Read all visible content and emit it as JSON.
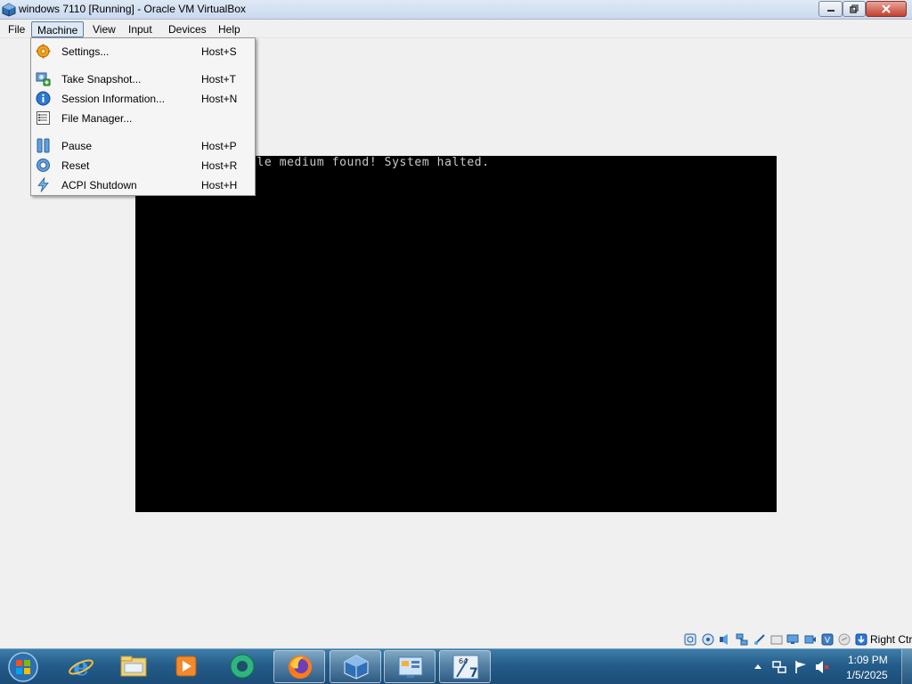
{
  "window": {
    "title": "windows 7110 [Running] - Oracle VM VirtualBox"
  },
  "menubar": {
    "items": [
      "File",
      "Machine",
      "View",
      "Input",
      "Devices",
      "Help"
    ]
  },
  "machine_menu": {
    "items": [
      {
        "label": "Settings...",
        "shortcut": "Host+S",
        "icon": "settings-gear-icon"
      },
      {
        "label": "Take Snapshot...",
        "shortcut": "Host+T",
        "icon": "snapshot-icon"
      },
      {
        "label": "Session Information...",
        "shortcut": "Host+N",
        "icon": "info-icon"
      },
      {
        "label": "File Manager...",
        "shortcut": "",
        "icon": "file-manager-icon"
      },
      {
        "label": "Pause",
        "shortcut": "Host+P",
        "icon": "pause-icon"
      },
      {
        "label": "Reset",
        "shortcut": "Host+R",
        "icon": "reset-icon"
      },
      {
        "label": "ACPI Shutdown",
        "shortcut": "Host+H",
        "icon": "acpi-shutdown-icon"
      }
    ]
  },
  "vm_screen": {
    "message": "ble medium found! System halted."
  },
  "statusbar": {
    "host_key": "Right Ctrl",
    "icons": [
      "hard-disk-icon",
      "optical-drive-icon",
      "audio-icon",
      "network-icon",
      "usb-icon",
      "shared-folders-icon",
      "display-icon",
      "recording-icon",
      "virtualization-icon",
      "mouse-integration-icon",
      "keyboard-capture-icon"
    ]
  },
  "taskbar": {
    "apps": [
      "internet-explorer-icon",
      "file-explorer-icon",
      "media-player-icon",
      "app-circle-icon",
      "firefox-icon",
      "virtualbox-icon",
      "control-panel-icon",
      "windows7-vm-icon"
    ],
    "tray": [
      "show-hidden-icons-icon",
      "network-tray-icon",
      "action-center-icon",
      "volume-muted-icon"
    ],
    "time": "1:09 PM",
    "date": "1/5/2025"
  },
  "colors": {
    "taskbar": "#245c8a",
    "menu_highlight": "#dde8f6",
    "vm_background": "#000000"
  }
}
